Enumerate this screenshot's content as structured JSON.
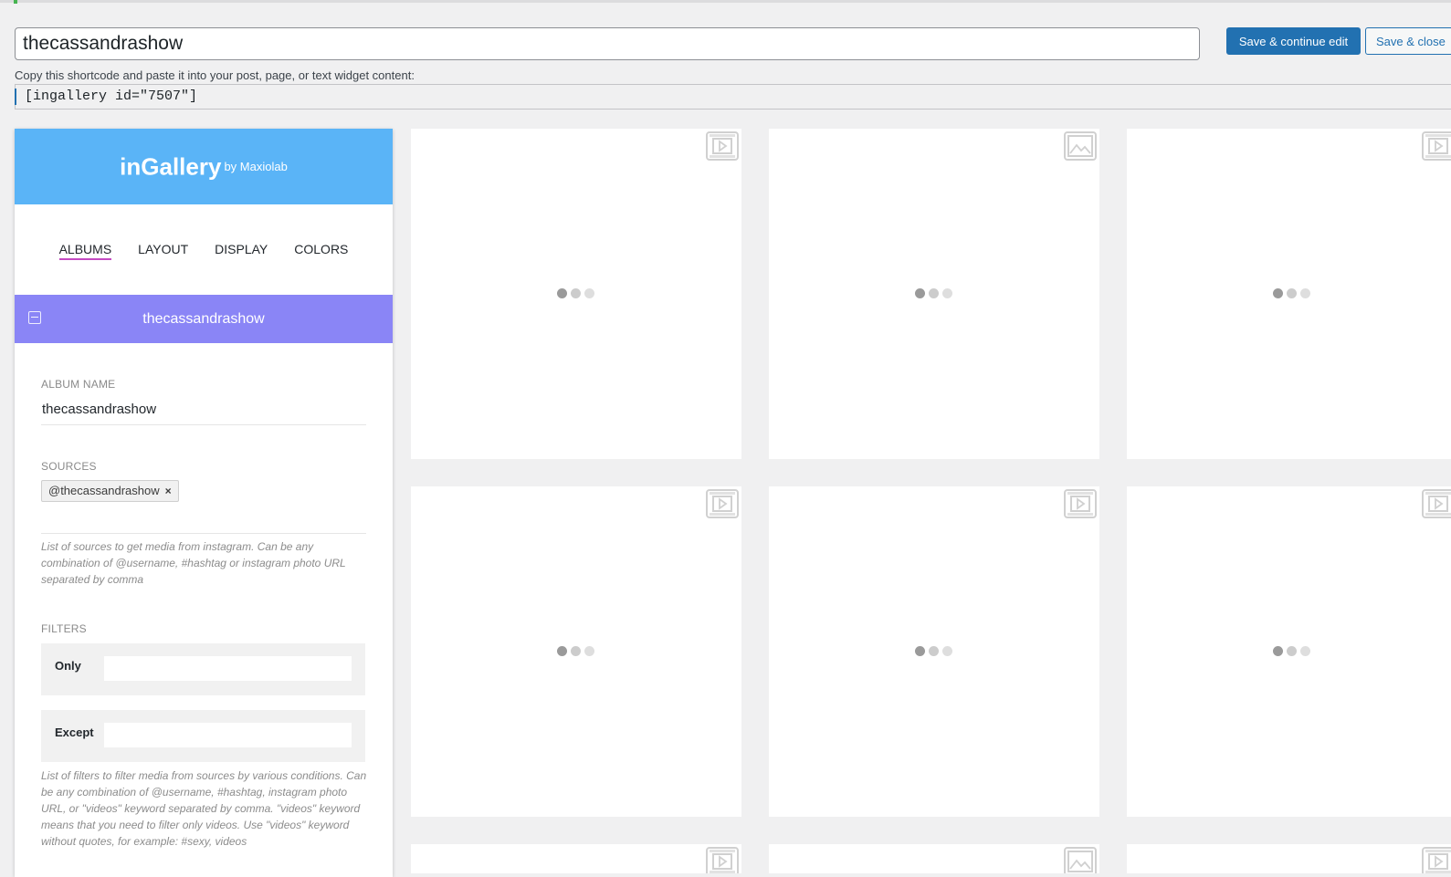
{
  "editor": {
    "title_value": "thecassandrashow",
    "save_continue_label": "Save & continue edit",
    "save_close_label": "Save & close",
    "shortcode_label": "Copy this shortcode and paste it into your post, page, or text widget content:",
    "shortcode": "[ingallery id=\"7507\"]"
  },
  "panel": {
    "brand": "inGallery",
    "brand_by": "by Maxiolab",
    "tabs": [
      "ALBUMS",
      "LAYOUT",
      "DISPLAY",
      "COLORS"
    ],
    "active_tab": "ALBUMS",
    "album_title": "thecassandrashow",
    "album_name_label": "ALBUM NAME",
    "album_name_value": "thecassandrashow",
    "sources_label": "SOURCES",
    "source_tag": "@thecassandrashow",
    "source_tag_remove": "×",
    "sources_help": "List of sources to get media from instagram. Can be any combination of @username, #hashtag or instagram photo URL separated by comma",
    "filters_label": "FILTERS",
    "filter_only_label": "Only",
    "filter_except_label": "Except",
    "filters_help": "List of filters to filter media from sources by various conditions. Can be any combination of @username, #hashtag, instagram photo URL, or \"videos\" keyword separated by comma. \"videos\" keyword means that you need to filter only videos. Use \"videos\" keyword without quotes, for example: #sexy, videos"
  },
  "grid": {
    "tiles": [
      {
        "icon": "video-icon"
      },
      {
        "icon": "image-icon"
      },
      {
        "icon": "video-icon"
      },
      {
        "icon": "video-icon"
      },
      {
        "icon": "video-icon"
      },
      {
        "icon": "video-icon"
      },
      {
        "icon": "video-icon"
      },
      {
        "icon": "image-icon"
      },
      {
        "icon": "video-icon"
      }
    ]
  },
  "colors": {
    "header_blue": "#5ab4f7",
    "album_purple": "#8a85f6",
    "tab_underline": "#c44ac2",
    "primary_button": "#2271b1"
  }
}
